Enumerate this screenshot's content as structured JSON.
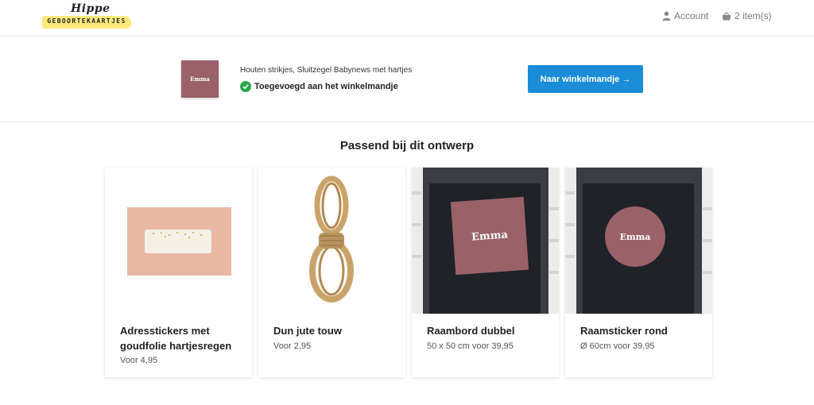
{
  "header": {
    "logo_script": "Hippe",
    "logo_sub": "GEBOORTEKAARTJES",
    "account_label": "Account",
    "cart_label": "2 item(s)",
    "icons": {
      "account": "user-icon",
      "cart": "basket-icon"
    }
  },
  "added": {
    "thumb_label": "Emma",
    "product_name": "Houten strikjes, Sluitzegel Babynews met hartjes",
    "status": "Toegevoegd aan het winkelmandje",
    "button_label": "Naar winkelmandje →"
  },
  "section": {
    "title": "Passend bij dit ontwerp"
  },
  "products": [
    {
      "title": "Adresstickers met goudfolie hartjesregen",
      "price": "Voor 4,95"
    },
    {
      "title": "Dun jute touw",
      "price": "Voor 2,95"
    },
    {
      "title": "Raambord dubbel",
      "price": "50 x 50 cm voor 39,95",
      "sign_label": "Emma"
    },
    {
      "title": "Raamsticker rond",
      "price": "Ø 60cm voor 39,95",
      "sign_label": "Emma"
    }
  ],
  "colors": {
    "accent": "#1a8cd8",
    "success": "#2ba84a",
    "brand_yellow": "#fde97a",
    "mauve": "#9a6268"
  }
}
